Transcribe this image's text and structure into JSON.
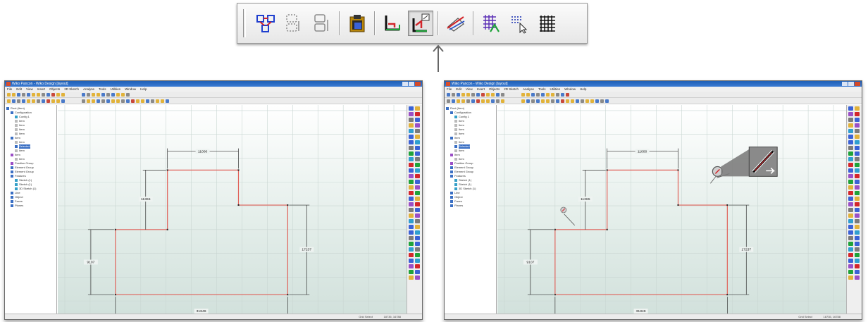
{
  "toolbar": {
    "buttons": [
      {
        "name": "topology-icon",
        "active": false
      },
      {
        "name": "wire-select-dim-icon",
        "active": false
      },
      {
        "name": "wire-select-dim-2-icon",
        "active": false
      },
      {
        "name": "clipboard-icon",
        "active": false
      },
      {
        "name": "floor-outline-icon",
        "active": false
      },
      {
        "name": "wall-edit-icon",
        "active": true
      },
      {
        "name": "cut-plane-icon",
        "active": false
      },
      {
        "name": "grid-edit-icon",
        "active": false
      },
      {
        "name": "grid-select-icon",
        "active": false
      },
      {
        "name": "grid-icon",
        "active": false
      }
    ]
  },
  "window": {
    "title": "Wiko Pancon - Wiko Design [layout]",
    "menu": [
      "File",
      "Edit",
      "View",
      "Insert",
      "Objects",
      "2D Sketch",
      "Analyse",
      "Tools",
      "Utilities",
      "Window",
      "Help"
    ],
    "tree": [
      {
        "label": "Root (Item)",
        "icon": "b",
        "indent": 0
      },
      {
        "label": "Configuration",
        "icon": "b",
        "indent": 1
      },
      {
        "label": "Config 1",
        "icon": "c",
        "indent": 2
      },
      {
        "label": "Item",
        "icon": "gr",
        "indent": 2
      },
      {
        "label": "Item",
        "icon": "gr",
        "indent": 2
      },
      {
        "label": "Item",
        "icon": "gr",
        "indent": 2
      },
      {
        "label": "Item",
        "icon": "gr",
        "indent": 2
      },
      {
        "label": "Item",
        "icon": "b",
        "indent": 1
      },
      {
        "label": "Item",
        "icon": "gr",
        "indent": 2
      },
      {
        "label": "Selected",
        "icon": "b",
        "indent": 2,
        "selected": true
      },
      {
        "label": "Item",
        "icon": "gr",
        "indent": 2
      },
      {
        "label": "Item",
        "icon": "p",
        "indent": 1
      },
      {
        "label": "Item",
        "icon": "gr",
        "indent": 2
      },
      {
        "label": "Position Group",
        "icon": "p",
        "indent": 1
      },
      {
        "label": "Element Group",
        "icon": "b",
        "indent": 1
      },
      {
        "label": "Element Group",
        "icon": "b",
        "indent": 1
      },
      {
        "label": "Features",
        "icon": "b",
        "indent": 1
      },
      {
        "label": "Sketch (1)",
        "icon": "c",
        "indent": 2
      },
      {
        "label": "Sketch (1)",
        "icon": "c",
        "indent": 2
      },
      {
        "label": "3D Sketch (1)",
        "icon": "c",
        "indent": 2
      },
      {
        "label": "Line",
        "icon": "b",
        "indent": 1
      },
      {
        "label": "Object",
        "icon": "b",
        "indent": 1
      },
      {
        "label": "Faces",
        "icon": "b",
        "indent": 1
      },
      {
        "label": "Planes",
        "icon": "b",
        "indent": 1
      }
    ],
    "status_left": "Grid Select",
    "status_right": "18735, 16788"
  },
  "drawing": {
    "dimensions": {
      "top_width": "11000",
      "left_upper_height": "11365",
      "right_height": "17237",
      "left_lower_height": "9107",
      "bottom_width": "31849"
    }
  },
  "colors": {
    "outline": "#e0625a",
    "active_toolbar": "#e2e2e2"
  }
}
